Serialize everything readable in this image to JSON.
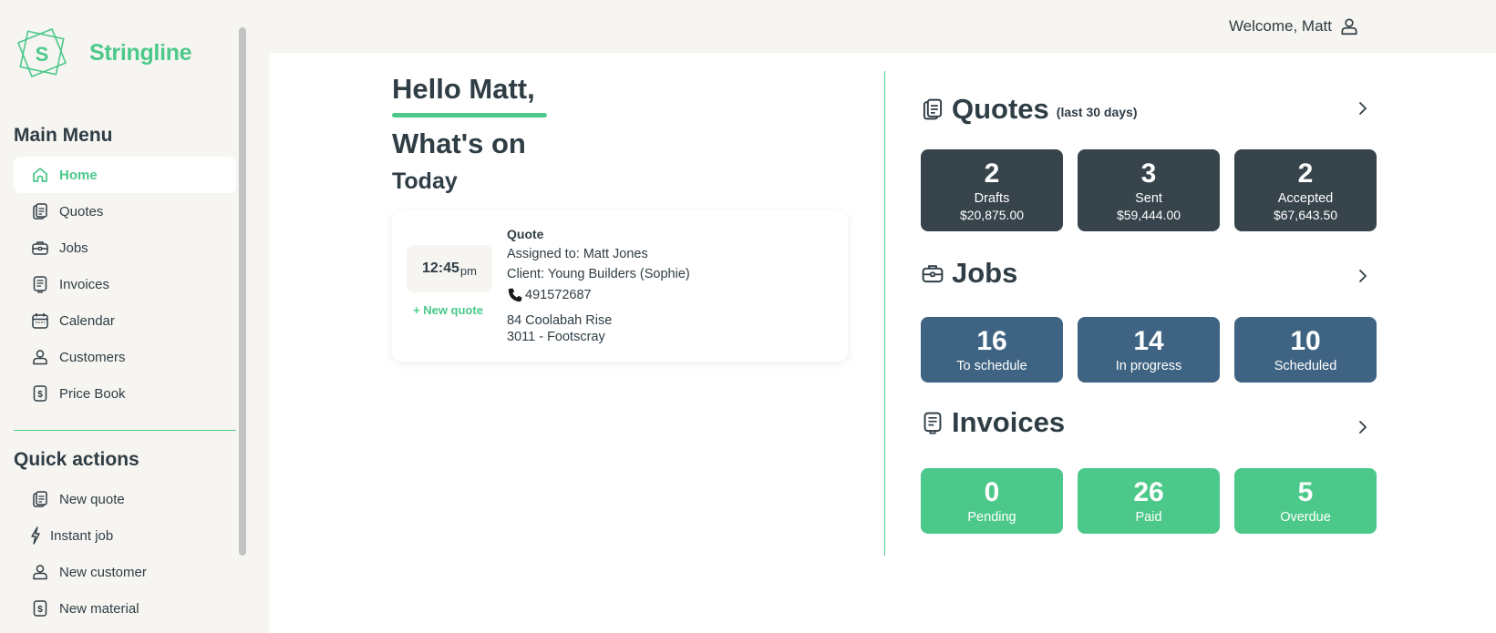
{
  "brand": {
    "name": "Stringline",
    "logo_letter": "S",
    "color": "#4cc98a"
  },
  "header": {
    "welcome": "Welcome, Matt"
  },
  "sidebar": {
    "main_menu_title": "Main Menu",
    "items": [
      {
        "label": "Home",
        "icon": "home-icon",
        "active": true
      },
      {
        "label": "Quotes",
        "icon": "quote-doc-icon"
      },
      {
        "label": "Jobs",
        "icon": "briefcase-icon"
      },
      {
        "label": "Invoices",
        "icon": "invoice-icon"
      },
      {
        "label": "Calendar",
        "icon": "calendar-icon"
      },
      {
        "label": "Customers",
        "icon": "person-icon"
      },
      {
        "label": "Price Book",
        "icon": "dollar-icon"
      }
    ],
    "quick_actions_title": "Quick actions",
    "quick_actions": [
      {
        "label": "New quote",
        "icon": "quote-doc-icon"
      },
      {
        "label": "Instant job",
        "icon": "lightning-icon"
      },
      {
        "label": "New customer",
        "icon": "person-icon"
      },
      {
        "label": "New material",
        "icon": "dollar-icon"
      }
    ]
  },
  "main": {
    "greeting": "Hello Matt,",
    "whats_on": "What's on",
    "today": "Today",
    "event": {
      "time": "12:45",
      "time_suffix": "pm",
      "type": "Quote",
      "assigned": "Assigned to: Matt Jones",
      "client": "Client: Young Builders (Sophie)",
      "phone": "491572687",
      "address_line1": "84 Coolabah Rise",
      "address_line2": "3011 - Footscray",
      "action": "+ New quote"
    }
  },
  "quotes": {
    "title": "Quotes",
    "subtitle": "(last 30 days)",
    "tiles": [
      {
        "value": "2",
        "label": "Drafts",
        "amount": "$20,875.00"
      },
      {
        "value": "3",
        "label": "Sent",
        "amount": "$59,444.00"
      },
      {
        "value": "2",
        "label": "Accepted",
        "amount": "$67,643.50"
      }
    ]
  },
  "jobs": {
    "title": "Jobs",
    "tiles": [
      {
        "value": "16",
        "label": "To schedule"
      },
      {
        "value": "14",
        "label": "In progress"
      },
      {
        "value": "10",
        "label": "Scheduled"
      }
    ]
  },
  "invoices": {
    "title": "Invoices",
    "tiles": [
      {
        "value": "0",
        "label": "Pending"
      },
      {
        "value": "26",
        "label": "Paid"
      },
      {
        "value": "5",
        "label": "Overdue"
      }
    ]
  },
  "colors": {
    "accent": "#4cc98a",
    "dark_tile": "#37444b",
    "blue_tile": "#3f6483",
    "text": "#2f3d45"
  }
}
